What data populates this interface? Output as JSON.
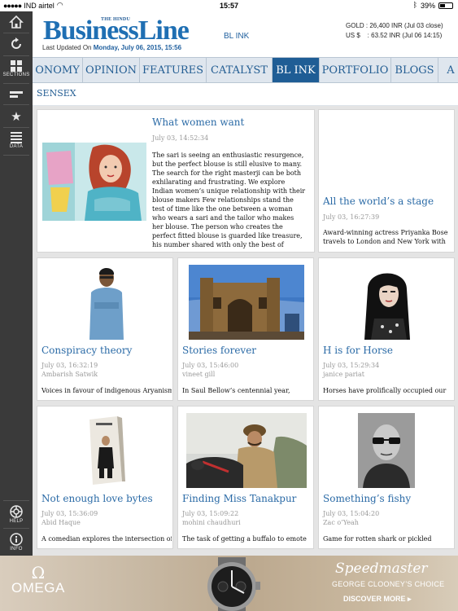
{
  "status_bar": {
    "carrier": "IND airtel",
    "time": "15:57",
    "battery": "39%"
  },
  "sidebar": {
    "items": [
      {
        "icon": "home-icon",
        "label": ""
      },
      {
        "icon": "refresh-icon",
        "label": ""
      },
      {
        "icon": "grid-icon",
        "label": "SECTIONS"
      },
      {
        "icon": "ticker-icon",
        "label": ""
      },
      {
        "icon": "star-icon",
        "label": ""
      },
      {
        "icon": "list-icon",
        "label": "DATA"
      },
      {
        "icon": "help-icon",
        "label": "HELP"
      },
      {
        "icon": "info-icon",
        "label": "INFO"
      }
    ]
  },
  "header": {
    "masthead_small": "THE HINDU",
    "logo": "BusinessLine",
    "updated_prefix": "Last Updated On",
    "updated_date": "Monday, July 06, 2015, 15:56",
    "section_label": "BL INK",
    "gold": "GOLD : 26,400 INR (Jul 03 close)",
    "usd": "US $    : 63.52 INR (Jul 06 14:15)"
  },
  "nav": {
    "tabs": [
      "ONOMY",
      "OPINION",
      "FEATURES",
      "CATALYST",
      "BL INK",
      "PORTFOLIO",
      "BLOGS",
      "A"
    ],
    "active": "BL INK"
  },
  "subnav": {
    "label": "SENSEX"
  },
  "articles": [
    {
      "title": "What women want",
      "date": "July 03, 14:52:34",
      "author": "",
      "text": "The sari is seeing an enthusiastic resurgence, but the perfect blouse is still elusive to many. The search for the right masterji can be both exhilarating and frustrating. We explore Indian women’s unique relationship with their blouse makers Few relationships stand the test of time like the one between a woman who wears a sari and the tailor who makes her blouse. The person who creates the perfect fitted blouse is guarded like treasure, his number shared with only the best of friends. But like you kiss many frogs u…"
    },
    {
      "title": "All the world’s a stage",
      "date": "July 03, 16:27:39",
      "author": "",
      "text": "Award-winning actress Priyanka Bose travels to London and New York with"
    },
    {
      "title": "Conspiracy theory",
      "date": "July 03, 16:32:19",
      "author": "Ambarish Satwik",
      "text": "Voices in favour of indigenous Aryanism"
    },
    {
      "title": "Stories forever",
      "date": "July 03, 15:46:00",
      "author": "vineet gill",
      "text": "In Saul Bellow’s centennial year,"
    },
    {
      "title": "H is for Horse",
      "date": "July 03, 15:29:34",
      "author": "janice pariat",
      "text": "Horses have prolifically occupied our"
    },
    {
      "title": "Not enough love bytes",
      "date": "July 03, 15:36:09",
      "author": "Abid Haque",
      "text": "A comedian explores the intersection of"
    },
    {
      "title": "Finding Miss Tanakpur",
      "date": "July 03, 15:09:22",
      "author": "mohini chaudhuri",
      "text": "The task of getting a buffalo to emote"
    },
    {
      "title": "Something’s fishy",
      "date": "July 03, 15:04:20",
      "author": "Zac o’Yeah",
      "text": "Game for rotten shark or pickled"
    }
  ],
  "ad": {
    "brand": "OMEGA",
    "product": "Speedmaster",
    "tagline": "GEORGE CLOONEY’S CHOICE",
    "cta": "DISCOVER MORE ▸"
  }
}
